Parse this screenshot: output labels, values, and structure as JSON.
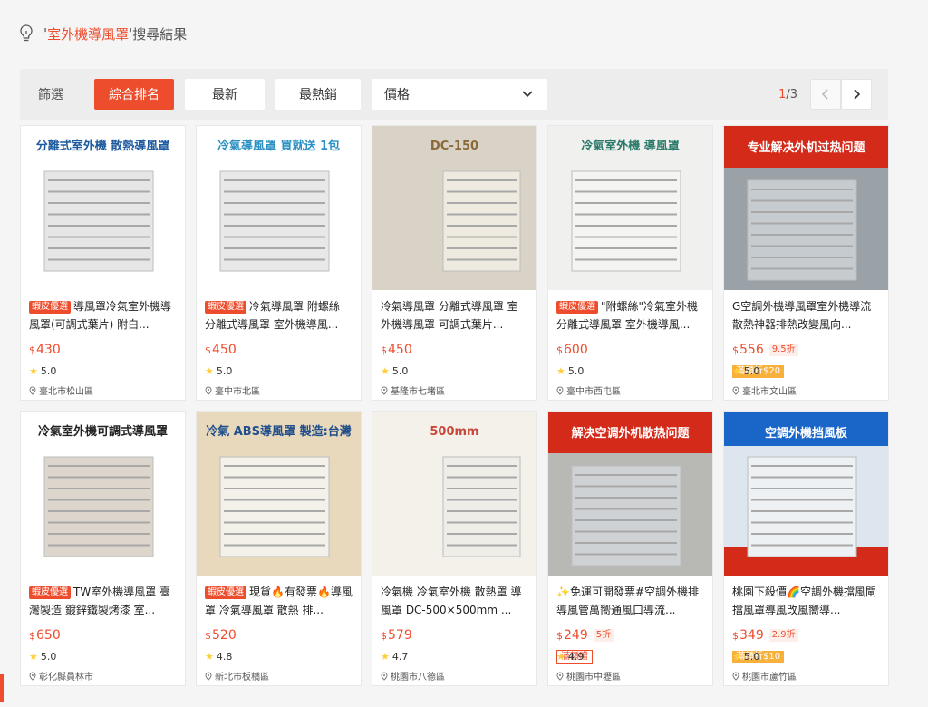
{
  "search": {
    "quote_open": "'",
    "keyword": "室外機導風罩",
    "quote_close": "'",
    "suffix": "搜尋結果"
  },
  "filter": {
    "label": "篩選",
    "sort_relevance": "綜合排名",
    "sort_latest": "最新",
    "sort_top_sales": "最熱銷",
    "price_label": "價格"
  },
  "pagination": {
    "current": "1",
    "total": "/3"
  },
  "colors": {
    "accent": "#ee4d2d",
    "star": "#ffce3d",
    "promo_gold": "#f7b03a"
  },
  "products": [
    {
      "tag": "蝦皮優選",
      "title": "導風罩冷氣室外機導風罩(可調式葉片) 附白...",
      "currency": "$",
      "price": "430",
      "discount": "",
      "promo": "",
      "rating": "5.0",
      "location": "臺北市松山區",
      "img_text": "分離式室外機 散熱導風罩"
    },
    {
      "tag": "蝦皮優選",
      "title": "冷氣導風罩 附螺絲 分離式導風罩 室外機導風...",
      "currency": "$",
      "price": "450",
      "discount": "",
      "promo": "",
      "rating": "5.0",
      "location": "臺中市北區",
      "img_text": "冷氣導風罩 買就送 1包"
    },
    {
      "tag": "",
      "title": "冷氣導風罩 分離式導風罩 室外機導風罩 可調式葉片...",
      "currency": "$",
      "price": "450",
      "discount": "",
      "promo": "",
      "rating": "5.0",
      "location": "基隆市七堵區",
      "img_text": "DC-150"
    },
    {
      "tag": "蝦皮優選",
      "title": "\"附螺絲\"冷氣室外機 分離式導風罩 室外機導風...",
      "currency": "$",
      "price": "600",
      "discount": "",
      "promo": "",
      "rating": "5.0",
      "location": "臺中市西屯區",
      "img_text": "冷氣室外機 導風罩"
    },
    {
      "tag": "",
      "title": "G空調外機導風罩室外機導流散熱神器排熱改變風向...",
      "currency": "$",
      "price": "556",
      "discount": "9.5折",
      "promo": "滿額折$20",
      "promo_style": "gold",
      "rating": "5.0",
      "location": "臺北市文山區",
      "img_text": "专业解决外机过热问题"
    },
    {
      "tag": "蝦皮優選",
      "title": "TW室外機導風罩 臺灣製造 鍍鋅鐵製烤漆 室...",
      "currency": "$",
      "price": "650",
      "discount": "",
      "promo": "",
      "rating": "5.0",
      "location": "彰化縣員林市",
      "img_text": "冷氣室外機可調式導風罩"
    },
    {
      "tag": "蝦皮優選",
      "title": "現貨🔥有發票🔥導風罩 冷氣導風罩 散熱 排...",
      "currency": "$",
      "price": "520",
      "discount": "",
      "promo": "",
      "rating": "4.8",
      "location": "新北市板橋區",
      "img_text": "冷氣 ABS導風罩 製造:台灣"
    },
    {
      "tag": "",
      "title": "冷氣機 冷氣室外機 散熱罩 導風罩 DC-500×500mm ...",
      "currency": "$",
      "price": "579",
      "discount": "",
      "promo": "",
      "rating": "4.7",
      "location": "桃園市八德區",
      "img_text": "500mm"
    },
    {
      "tag": "",
      "title": "✨免運可開發票#空調外機排導風管萬嚮通風口導流...",
      "currency": "$",
      "price": "249",
      "discount": "5折",
      "promo": "滿額贈",
      "promo_style": "outline",
      "rating": "4.9",
      "location": "桃園市中壢區",
      "img_text": "解决空调外机散热问题"
    },
    {
      "tag": "",
      "title": "桃園下殺價🌈空調外機擋風閘擋風罩導風改風嚮導...",
      "currency": "$",
      "price": "349",
      "discount": "2.9折",
      "promo": "滿額折$10",
      "promo_style": "gold",
      "rating": "5.0",
      "location": "桃園市蘆竹區",
      "img_text": "空調外機挡風板"
    }
  ]
}
